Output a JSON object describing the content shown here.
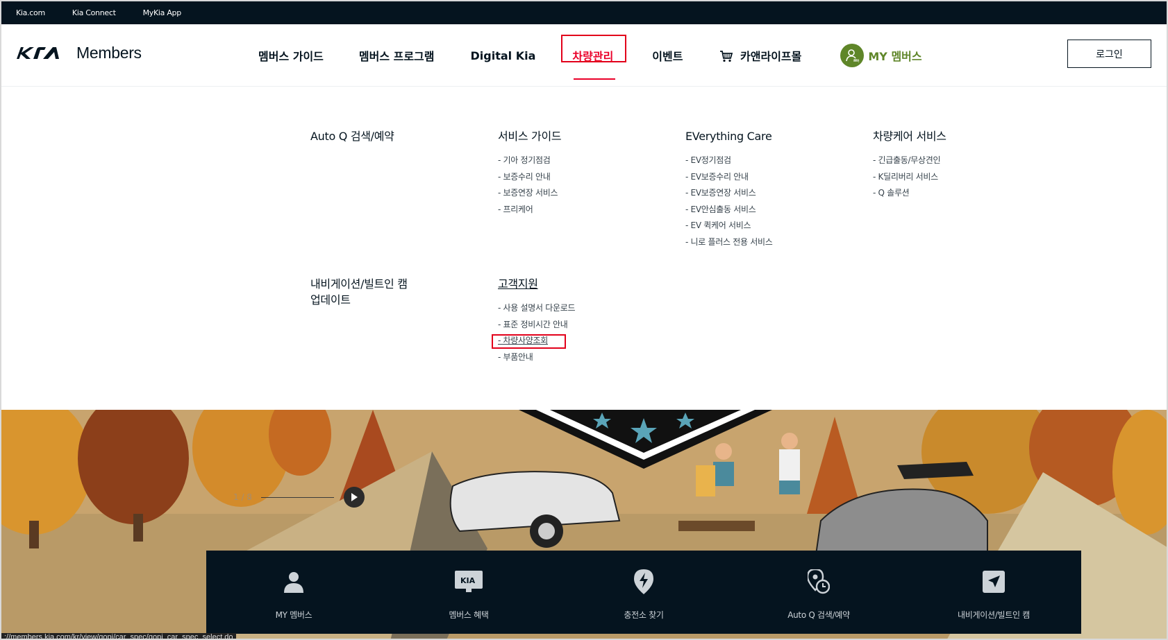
{
  "topbar": {
    "links": [
      "Kia.com",
      "Kia Connect",
      "MyKia App"
    ]
  },
  "header": {
    "brand": "Members",
    "nav": [
      "멤버스 가이드",
      "멤버스 프로그램",
      "Digital Kia",
      "차량관리",
      "이벤트",
      "카앤라이프몰"
    ],
    "my_label": "MY 멤버스",
    "login_label": "로그인"
  },
  "mega": {
    "auto_q": {
      "title": "Auto Q 검색/예약"
    },
    "service_guide": {
      "title": "서비스 가이드",
      "items": [
        "- 기아 정기점검",
        "- 보증수리 안내",
        "- 보증연장 서비스",
        "- 프리케어"
      ]
    },
    "everything_care": {
      "title": "EVerything Care",
      "items": [
        "- EV정기점검",
        "- EV보증수리 안내",
        "- EV보증연장 서비스",
        "- EV안심출동 서비스",
        "- EV 퀵케어 서비스",
        "- 니로 플러스 전용 서비스"
      ]
    },
    "car_care": {
      "title": "차량케어 서비스",
      "items": [
        "- 긴급출동/무상견인",
        "- K딜리버리 서비스",
        "- Q 솔루션"
      ]
    },
    "navigation": {
      "title_line1": "내비게이션/빌트인 캠",
      "title_line2": "업데이트"
    },
    "customer": {
      "title": "고객지원",
      "items": [
        "- 사용 설명서 다운로드",
        "- 표준 정비시간 안내",
        "- 차량사양조회",
        "- 부품안내"
      ]
    }
  },
  "slider": {
    "page": "1 / 8"
  },
  "quick_menu": [
    "MY 멤버스",
    "멤버스 혜택",
    "충전소 찾기",
    "Auto Q 검색/예약",
    "내비게이션/빌트인 캠"
  ],
  "status_url": "://members.kia.com/kr/view/qopi/car_spec/qopi_car_spec_select.do",
  "colors": {
    "brand_dark": "#05141f",
    "accent_red": "#ea0029",
    "my_green": "#5f8629"
  }
}
